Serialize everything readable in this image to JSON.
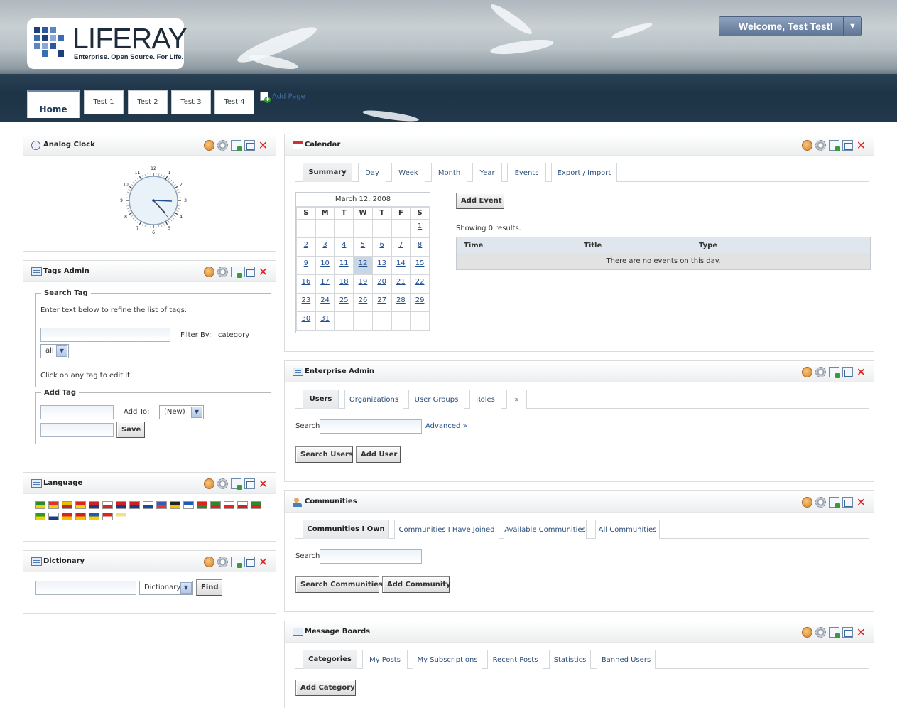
{
  "header": {
    "logo_text": "LIFERAY",
    "logo_tagline": "Enterprise. Open Source. For Life.",
    "welcome": "Welcome, Test Test!",
    "welcome_arrow": "▼",
    "nav_tabs": [
      "Home",
      "Test 1",
      "Test 2",
      "Test 3",
      "Test 4"
    ],
    "add_page": "Add Page"
  },
  "clock": {
    "title": "Analog Clock",
    "numbers": [
      "12",
      "1",
      "2",
      "3",
      "4",
      "5",
      "6",
      "7",
      "8",
      "9",
      "10",
      "11"
    ]
  },
  "tags_admin": {
    "title": "Tags Admin",
    "search_legend": "Search Tag",
    "instructions": "Enter text below to refine the list of tags.",
    "filter_label": "Filter By:",
    "filter_value": "category",
    "filter_select": "all",
    "click_hint": "Click on any tag to edit it.",
    "add_legend": "Add Tag",
    "add_to_label": "Add To:",
    "add_to_select": "(New)",
    "save": "Save"
  },
  "language": {
    "title": "Language",
    "flag_colors": [
      [
        "#2a8a2a",
        "#f4d000"
      ],
      [
        "#e03030",
        "#f4d000"
      ],
      [
        "#e8c000",
        "#c22"
      ],
      [
        "#d22",
        "#ffd700"
      ],
      [
        "#c22",
        "#1a3a8a"
      ],
      [
        "#fff",
        "#d22"
      ],
      [
        "#c22",
        "#1a3a8a"
      ],
      [
        "#c22",
        "#1a3a8a"
      ],
      [
        "#fff",
        "#1a4a9a"
      ],
      [
        "#3a5ab8",
        "#e33"
      ],
      [
        "#222",
        "#f2c100"
      ],
      [
        "#1a5ab8",
        "#fff"
      ],
      [
        "#d22",
        "#2a8a2a"
      ],
      [
        "#2a8a2a",
        "#d22"
      ],
      [
        "#fff",
        "#e22"
      ],
      [
        "#fff",
        "#c22"
      ],
      [
        "#2a8a2a",
        "#d22"
      ],
      [
        "#2a9a2a",
        "#f4d000"
      ],
      [
        "#fff",
        "#1a3a8a"
      ],
      [
        "#d22",
        "#f4c000"
      ],
      [
        "#c22",
        "#f4c000"
      ],
      [
        "#1a5ab8",
        "#f4d000"
      ],
      [
        "#d22",
        "#fff"
      ],
      [
        "#f4e080",
        "#fff"
      ]
    ]
  },
  "dictionary": {
    "title": "Dictionary",
    "select": "Dictionary",
    "find": "Find"
  },
  "calendar": {
    "title": "Calendar",
    "tabs": [
      "Summary",
      "Day",
      "Week",
      "Month",
      "Year",
      "Events",
      "Export / Import"
    ],
    "month_label": "March 12, 2008",
    "day_names": [
      "S",
      "M",
      "T",
      "W",
      "T",
      "F",
      "S"
    ],
    "weeks": [
      [
        "",
        "",
        "",
        "",
        "",
        "",
        "1"
      ],
      [
        "2",
        "3",
        "4",
        "5",
        "6",
        "7",
        "8"
      ],
      [
        "9",
        "10",
        "11",
        "12",
        "13",
        "14",
        "15"
      ],
      [
        "16",
        "17",
        "18",
        "19",
        "20",
        "21",
        "22"
      ],
      [
        "23",
        "24",
        "25",
        "26",
        "27",
        "28",
        "29"
      ],
      [
        "30",
        "31",
        "",
        "",
        "",
        "",
        ""
      ]
    ],
    "today": "12",
    "add_event": "Add Event",
    "results": "Showing 0 results.",
    "columns": [
      "Time",
      "Title",
      "Type"
    ],
    "empty": "There are no events on this day."
  },
  "enterprise_admin": {
    "title": "Enterprise Admin",
    "tabs": [
      "Users",
      "Organizations",
      "User Groups",
      "Roles",
      "»"
    ],
    "search_label": "Search",
    "advanced": "Advanced »",
    "search_users": "Search Users",
    "add_user": "Add User"
  },
  "communities": {
    "title": "Communities",
    "tabs": [
      "Communities I Own",
      "Communities I Have Joined",
      "Available Communities",
      "All Communities"
    ],
    "search_label": "Search",
    "search_btn": "Search Communities",
    "add_btn": "Add Community"
  },
  "message_boards": {
    "title": "Message Boards",
    "tabs": [
      "Categories",
      "My Posts",
      "My Subscriptions",
      "Recent Posts",
      "Statistics",
      "Banned Users"
    ],
    "add_category": "Add Category"
  }
}
